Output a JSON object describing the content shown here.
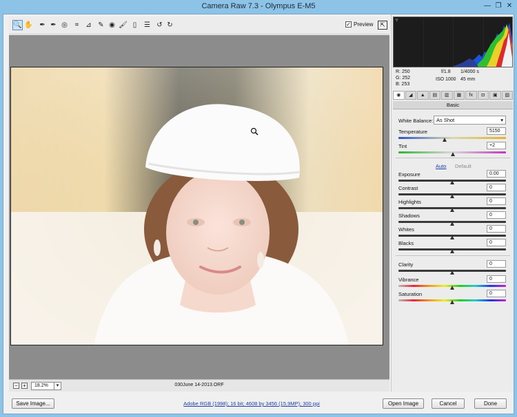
{
  "window": {
    "title": "Camera Raw 7.3  -  Olympus E-M5"
  },
  "toolbar": {
    "tools": [
      {
        "name": "zoom-tool",
        "glyph": "🔍"
      },
      {
        "name": "hand-tool",
        "glyph": "✋"
      },
      {
        "name": "white-balance-tool",
        "glyph": "✒"
      },
      {
        "name": "color-sampler-tool",
        "glyph": "✒"
      },
      {
        "name": "targeted-adjustment-tool",
        "glyph": "◎"
      },
      {
        "name": "crop-tool",
        "glyph": "⌗"
      },
      {
        "name": "straighten-tool",
        "glyph": "⊿"
      },
      {
        "name": "spot-removal-tool",
        "glyph": "✎"
      },
      {
        "name": "red-eye-tool",
        "glyph": "◉"
      },
      {
        "name": "adjustment-brush-tool",
        "glyph": "🖌"
      },
      {
        "name": "graduated-filter-tool",
        "glyph": "▯"
      },
      {
        "name": "preferences-tool",
        "glyph": "☰"
      },
      {
        "name": "rotate-left-tool",
        "glyph": "↺"
      },
      {
        "name": "rotate-right-tool",
        "glyph": "↻"
      }
    ],
    "preview_label": "Preview",
    "preview_checked": "✓"
  },
  "status": {
    "zoom": "18.2%",
    "filename": "030June 14-2013.ORF"
  },
  "readout": {
    "r": "R:  250",
    "g": "G:  252",
    "b": "B:  253",
    "aperture": "f/1.8",
    "shutter": "1/4000 s",
    "iso": "ISO 1000",
    "focal": "45 mm"
  },
  "tabs": [
    {
      "name": "tab-basic",
      "glyph": "◉",
      "active": true
    },
    {
      "name": "tab-tone-curve",
      "glyph": "◢"
    },
    {
      "name": "tab-detail",
      "glyph": "▲"
    },
    {
      "name": "tab-hsl",
      "glyph": "▤"
    },
    {
      "name": "tab-split-toning",
      "glyph": "▥"
    },
    {
      "name": "tab-lens-corrections",
      "glyph": "▦"
    },
    {
      "name": "tab-effects",
      "glyph": "fx"
    },
    {
      "name": "tab-camera-calibration",
      "glyph": "◘"
    },
    {
      "name": "tab-presets",
      "glyph": "▣"
    },
    {
      "name": "tab-snapshots",
      "glyph": "▧"
    }
  ],
  "basic": {
    "title": "Basic",
    "white_balance_label": "White Balance:",
    "white_balance_value": "As Shot",
    "auto": "Auto",
    "default": "Default",
    "sliders_top": [
      {
        "label": "Temperature",
        "value": "5150",
        "position": 0.43,
        "style": "temp"
      },
      {
        "label": "Tint",
        "value": "+2",
        "position": 0.51,
        "style": "tint"
      }
    ],
    "sliders_tone": [
      {
        "label": "Exposure",
        "value": "0.00",
        "position": 0.5
      },
      {
        "label": "Contrast",
        "value": "0",
        "position": 0.5
      },
      {
        "label": "Highlights",
        "value": "0",
        "position": 0.5
      },
      {
        "label": "Shadows",
        "value": "0",
        "position": 0.5
      },
      {
        "label": "Whites",
        "value": "0",
        "position": 0.5
      },
      {
        "label": "Blacks",
        "value": "0",
        "position": 0.5
      }
    ],
    "sliders_presence": [
      {
        "label": "Clarity",
        "value": "0",
        "position": 0.5,
        "style": "plain"
      },
      {
        "label": "Vibrance",
        "value": "0",
        "position": 0.5,
        "style": "rainbow"
      },
      {
        "label": "Saturation",
        "value": "0",
        "position": 0.5,
        "style": "rainbow"
      }
    ]
  },
  "bottom": {
    "save_label": "Save Image...",
    "workflow_label": "Adobe RGB (1998); 16 bit; 4608 by 3456 (15.9MP); 300 ppi",
    "open_label": "Open Image",
    "cancel_label": "Cancel",
    "done_label": "Done"
  }
}
